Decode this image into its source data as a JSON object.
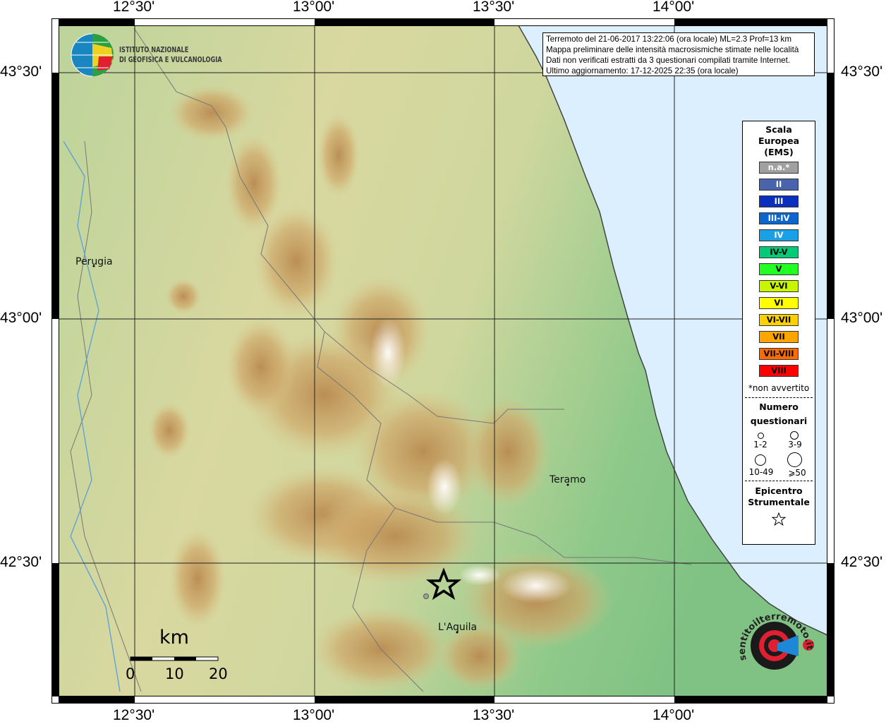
{
  "map": {
    "info": {
      "line1": "Terremoto del 21-06-2017 13:22:06 (ora locale) ML=2.3 Prof=13 km",
      "line2": "Mappa preliminare delle intensità macrosismiche stimate nelle località",
      "line3": "Dati non verificati estratti da 3 questionari compilati tramite Internet.",
      "line4": "Ultimo aggiornamento: 17-12-2025 22:35 (ora locale)"
    },
    "lon_ticks": [
      "12°30'",
      "13°00'",
      "13°30'",
      "14°00'"
    ],
    "lat_ticks": [
      "43°30'",
      "43°00'",
      "42°30'"
    ],
    "cities": {
      "perugia": "Perugia",
      "teramo": "Teramo",
      "laquila": "L'Aquila"
    },
    "scale": {
      "unit": "km",
      "labels": [
        "0",
        "10",
        "20"
      ]
    },
    "logo_ingv": {
      "line1": "ISTITUTO NAZIONALE",
      "line2": "DI GEOFISICA E VULCANOLOGIA"
    },
    "logo_hsit": "www.haisentitoilterremoto.it",
    "colors": {
      "sea": "#dcefff",
      "epicenter": "#000000"
    }
  },
  "legend": {
    "title": [
      "Scala",
      "Europea",
      "(EMS)"
    ],
    "scale": [
      {
        "label": "n.a.*",
        "color": "#a0a0a0",
        "text": "#ffffff"
      },
      {
        "label": "II",
        "color": "#4a63ad",
        "text": "#ffffff"
      },
      {
        "label": "III",
        "color": "#0a2fbf",
        "text": "#ffffff"
      },
      {
        "label": "III-IV",
        "color": "#0b66d0",
        "text": "#ffffff"
      },
      {
        "label": "IV",
        "color": "#1aa0e6",
        "text": "#ffffff"
      },
      {
        "label": "IV-V",
        "color": "#00cc77",
        "text": "#000000"
      },
      {
        "label": "V",
        "color": "#22ff22",
        "text": "#000000"
      },
      {
        "label": "V-VI",
        "color": "#c8f500",
        "text": "#000000"
      },
      {
        "label": "VI",
        "color": "#ffff00",
        "text": "#000000"
      },
      {
        "label": "VI-VII",
        "color": "#ffd000",
        "text": "#000000"
      },
      {
        "label": "VII",
        "color": "#ffa500",
        "text": "#000000"
      },
      {
        "label": "VII-VIII",
        "color": "#ff6a00",
        "text": "#000000"
      },
      {
        "label": "VIII",
        "color": "#ff0000",
        "text": "#000000"
      }
    ],
    "na_note": "*non avvertito",
    "questionnaires_title": [
      "Numero",
      "questionari"
    ],
    "questionnaires": [
      "1-2",
      "3-9",
      "10-49",
      "⩾50"
    ],
    "epicenter_title": [
      "Epicentro",
      "Strumentale"
    ]
  }
}
